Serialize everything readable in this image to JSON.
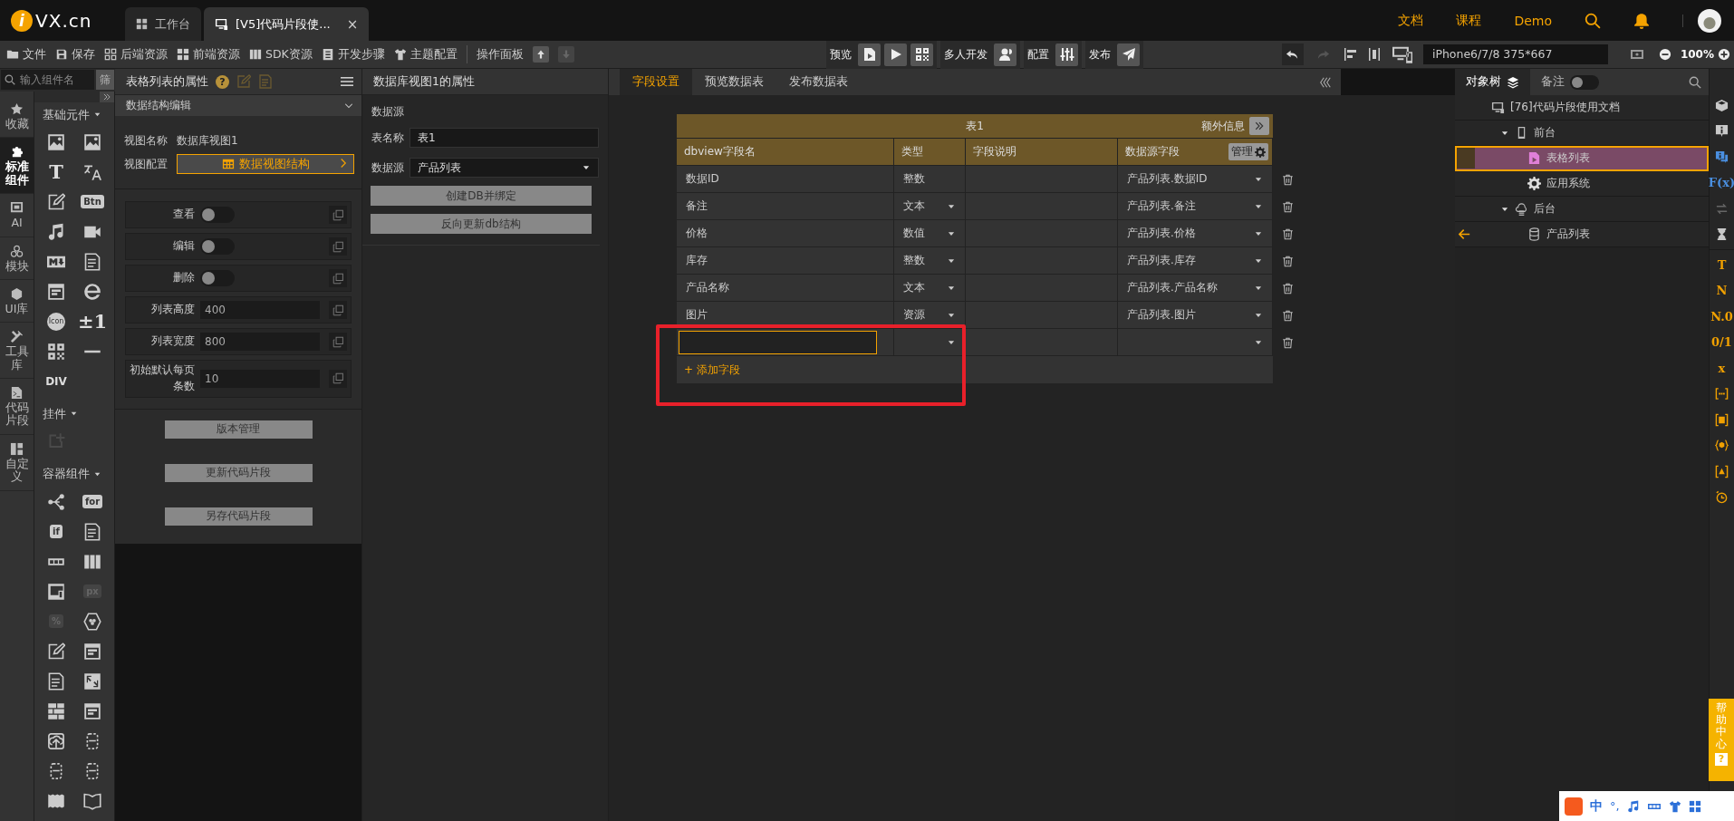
{
  "topbar": {
    "logo": {
      "mark": "i",
      "text": "VX.cn"
    },
    "tabs": [
      {
        "label": "工作台",
        "selected": false
      },
      {
        "label": "[V5]代码片段使...",
        "selected": true,
        "close": "×"
      }
    ],
    "links": [
      "文档",
      "课程",
      "Demo"
    ]
  },
  "toolbar": {
    "menu": [
      "文件",
      "保存",
      "后端资源",
      "前端资源",
      "SDK资源",
      "开发步骤",
      "主题配置"
    ],
    "panel_label": "操作面板",
    "move_buttons": [
      {
        "disabled": false
      },
      {
        "disabled": true
      }
    ],
    "groups": [
      {
        "label": "预览"
      },
      {
        "label": "多人开发"
      },
      {
        "label": "配置"
      },
      {
        "label": "发布"
      }
    ],
    "history": [
      {
        "disabled": false
      },
      {
        "disabled": true
      }
    ],
    "device": "iPhone6/7/8 375*667",
    "zoom": "100%"
  },
  "left_rail": [
    {
      "label": "收藏",
      "selected": false
    },
    {
      "label": "标准组件",
      "selected": true
    },
    {
      "label": "AI",
      "selected": false
    },
    {
      "label": "模块",
      "selected": false
    },
    {
      "label": "UI库",
      "selected": false
    },
    {
      "label": "工具库",
      "selected": false
    },
    {
      "label": "代码片段",
      "selected": false
    },
    {
      "label": "自定义",
      "selected": false
    }
  ],
  "palette": {
    "search": {
      "placeholder": "输入组件名"
    },
    "filter": "筛",
    "sections": [
      {
        "title": "基础元件",
        "items": [
          {
            "kind": "icon",
            "disabled": false
          },
          {
            "kind": "icon",
            "disabled": false
          },
          {
            "kind": "glyph",
            "label": "T",
            "disabled": false
          },
          {
            "kind": "icon",
            "disabled": false
          },
          {
            "kind": "icon",
            "disabled": false
          },
          {
            "kind": "tag",
            "label": "Btn",
            "disabled": false
          },
          {
            "kind": "icon",
            "disabled": false
          },
          {
            "kind": "icon",
            "disabled": false
          },
          {
            "kind": "icon",
            "disabled": false
          },
          {
            "kind": "icon",
            "disabled": false
          },
          {
            "kind": "icon",
            "disabled": false
          },
          {
            "kind": "icon",
            "disabled": false
          },
          {
            "kind": "badge",
            "label": "Icon",
            "disabled": false
          },
          {
            "kind": "glyph",
            "label": "±1",
            "disabled": false
          },
          {
            "kind": "icon",
            "disabled": false
          },
          {
            "kind": "icon",
            "disabled": false
          },
          {
            "kind": "word",
            "label": "DIV",
            "disabled": false
          }
        ]
      },
      {
        "title": "挂件",
        "items": [
          {
            "kind": "icon",
            "disabled": true
          }
        ]
      },
      {
        "title": "容器组件",
        "items": [
          {
            "kind": "icon",
            "disabled": false
          },
          {
            "kind": "tag",
            "label": "for",
            "disabled": false
          },
          {
            "kind": "tag",
            "label": "if",
            "disabled": false
          },
          {
            "kind": "icon",
            "disabled": false
          },
          {
            "kind": "icon",
            "disabled": false
          },
          {
            "kind": "icon",
            "disabled": false
          },
          {
            "kind": "icon",
            "disabled": false
          },
          {
            "kind": "tag",
            "label": "px",
            "disabled": true
          },
          {
            "kind": "tag",
            "label": "%",
            "disabled": true
          },
          {
            "kind": "icon",
            "disabled": false
          },
          {
            "kind": "icon",
            "disabled": false
          },
          {
            "kind": "icon",
            "disabled": false
          },
          {
            "kind": "icon",
            "disabled": false
          },
          {
            "kind": "icon",
            "disabled": false
          },
          {
            "kind": "icon",
            "disabled": false
          },
          {
            "kind": "icon",
            "disabled": false
          },
          {
            "kind": "icon",
            "disabled": false
          },
          {
            "kind": "icon",
            "disabled": false
          },
          {
            "kind": "icon",
            "disabled": false
          },
          {
            "kind": "icon",
            "disabled": false
          },
          {
            "kind": "icon",
            "disabled": false
          },
          {
            "kind": "icon",
            "disabled": false
          }
        ]
      }
    ]
  },
  "properties": {
    "title": "表格列表的属性",
    "help": "?",
    "section": "数据结构编辑",
    "view_name": {
      "label": "视图名称",
      "value": "数据库视图1"
    },
    "view_config": {
      "label": "视图配置",
      "button": "数据视图结构"
    },
    "settings": [
      {
        "kind": "toggle",
        "label": "查看",
        "on": false
      },
      {
        "kind": "toggle",
        "label": "编辑",
        "on": false
      },
      {
        "kind": "toggle",
        "label": "删除",
        "on": false
      },
      {
        "kind": "input",
        "label": "列表高度",
        "value": "400"
      },
      {
        "kind": "input",
        "label": "列表宽度",
        "value": "800"
      },
      {
        "kind": "input",
        "label": "初始默认每页条数",
        "value": "10"
      }
    ],
    "buttons": [
      "版本管理",
      "更新代码片段",
      "另存代码片段"
    ]
  },
  "db_panel": {
    "title": "数据库视图1的属性",
    "section": "数据源",
    "table_name": {
      "label": "表名称",
      "value": "表1"
    },
    "source": {
      "label": "数据源",
      "value": "产品列表"
    },
    "buttons": [
      "创建DB并绑定",
      "反向更新db结构"
    ]
  },
  "field_editor": {
    "tabs": [
      {
        "label": "字段设置",
        "selected": true
      },
      {
        "label": "预览数据表",
        "selected": false
      },
      {
        "label": "发布数据表",
        "selected": false
      }
    ],
    "table": {
      "title": "表1",
      "extra": "额外信息",
      "columns": [
        "dbview字段名",
        "类型",
        "字段说明",
        "数据源字段"
      ],
      "manage": "管理",
      "rows": [
        {
          "kind": "field",
          "name": "数据ID",
          "type": "整数",
          "type_editable": false,
          "source": "产品列表.数据ID"
        },
        {
          "kind": "field",
          "name": "备注",
          "type": "文本",
          "type_editable": true,
          "source": "产品列表.备注"
        },
        {
          "kind": "field",
          "name": "价格",
          "type": "数值",
          "type_editable": true,
          "source": "产品列表.价格"
        },
        {
          "kind": "field",
          "name": "库存",
          "type": "整数",
          "type_editable": true,
          "source": "产品列表.库存"
        },
        {
          "kind": "field",
          "name": "产品名称",
          "type": "文本",
          "type_editable": true,
          "source": "产品列表.产品名称"
        },
        {
          "kind": "field",
          "name": "图片",
          "type": "资源",
          "type_editable": true,
          "source": "产品列表.图片"
        },
        {
          "kind": "new"
        }
      ],
      "add": "+ 添加字段"
    },
    "annotation": {
      "kind": "rectangle"
    }
  },
  "object_tree": {
    "tabs": [
      {
        "label": "对象树",
        "selected": true
      },
      {
        "label": "备注",
        "selected": false
      }
    ],
    "notes_toggle": {
      "on": false
    },
    "nodes": [
      {
        "kind": "project",
        "label": "[76]代码片段使用文档",
        "selected": false,
        "bound": false,
        "children": [
          {
            "kind": "client",
            "label": "前台",
            "expanded": true,
            "selected": false,
            "bound": false,
            "children": [
              {
                "kind": "page",
                "label": "表格列表",
                "selected": true,
                "bound": false
              },
              {
                "kind": "system",
                "label": "应用系统",
                "selected": false,
                "bound": false
              }
            ]
          },
          {
            "kind": "server",
            "label": "后台",
            "expanded": true,
            "selected": false,
            "bound": false,
            "children": [
              {
                "kind": "table",
                "label": "产品列表",
                "selected": false,
                "bound": true
              }
            ]
          }
        ]
      }
    ]
  },
  "side_strip": [
    {
      "kind": "icon",
      "color": "#c8c8c8"
    },
    {
      "kind": "icon",
      "color": "#c8c8c8"
    },
    {
      "kind": "icon",
      "color": "#4a8fe0"
    },
    {
      "kind": "glyph",
      "label": "F(x)",
      "color": "#4a8fe0"
    },
    {
      "kind": "icon",
      "color": "#666666"
    },
    {
      "kind": "icon",
      "color": "#c8c8c8"
    },
    {
      "kind": "glyph",
      "label": "T",
      "color": "#f0a000"
    },
    {
      "kind": "glyph",
      "label": "N",
      "color": "#f0a000"
    },
    {
      "kind": "glyph",
      "label": "N.0",
      "color": "#f0a000"
    },
    {
      "kind": "glyph",
      "label": "0/1",
      "color": "#f0a000"
    },
    {
      "kind": "glyph",
      "label": "x",
      "color": "#f0a000"
    },
    {
      "kind": "icon",
      "color": "#f0a000"
    },
    {
      "kind": "icon",
      "color": "#f0a000"
    },
    {
      "kind": "icon",
      "color": "#f0a000"
    },
    {
      "kind": "icon",
      "color": "#f0a000"
    },
    {
      "kind": "icon",
      "color": "#f0a000"
    }
  ],
  "help_tab": {
    "label": "帮助中心",
    "mark": "?"
  },
  "ime_bar": {
    "mode": "中",
    "punct": "°,"
  }
}
